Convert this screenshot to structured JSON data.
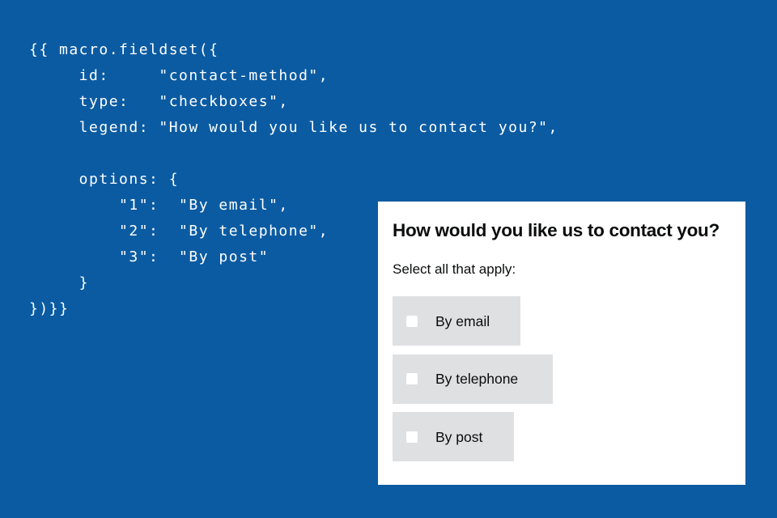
{
  "code": {
    "lines": [
      "{{ macro.fieldset({",
      "     id:     \"contact-method\",",
      "     type:   \"checkboxes\",",
      "     legend: \"How would you like us to contact you?\",",
      "",
      "     options: {",
      "         \"1\":  \"By email\",",
      "         \"2\":  \"By telephone\",",
      "         \"3\":  \"By post\"",
      "     }",
      "})}}"
    ]
  },
  "form": {
    "legend": "How would you like us to contact you?",
    "hint": "Select all that apply:",
    "options": [
      {
        "label": "By email",
        "checked": false
      },
      {
        "label": "By telephone",
        "checked": false
      },
      {
        "label": "By post",
        "checked": false
      }
    ]
  },
  "colors": {
    "background": "#0b5ba2",
    "panel": "#ffffff",
    "option_background": "#dee0e2",
    "text": "#0b0c0c"
  }
}
